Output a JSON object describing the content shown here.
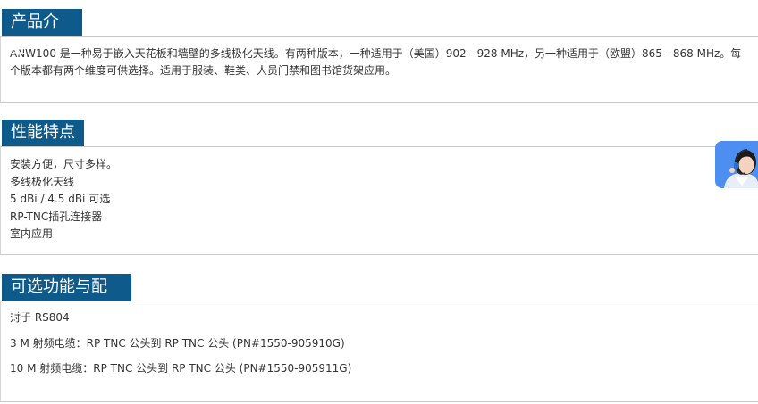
{
  "sections": {
    "intro": {
      "title": "产品介绍",
      "text": "ANW100 是一种易于嵌入天花板和墙壁的多线极化天线。有两种版本，一种适用于（美国）902 - 928 MHz，另一种适用于（欧盟）865 - 868 MHz。每个版本都有两个维度可供选择。适用于服装、鞋类、人员门禁和图书馆货架应用。"
    },
    "features": {
      "title": "性能特点",
      "items": [
        "安装方便，尺寸多样。",
        "多线极化天线",
        "5 dBi / 4.5 dBi 可选",
        "RP-TNC插孔连接器",
        "室内应用"
      ]
    },
    "accessories": {
      "title": "可选功能与配件",
      "items": [
        "对于 RS804",
        "3 M 射频电缆：RP TNC 公头到 RP TNC 公头 (PN#1550-905910G)",
        "10 M 射频电缆：RP TNC 公头到 RP TNC 公头 (PN#1550-905911G)"
      ]
    }
  },
  "widget": {
    "icon": "customer-service-agent-icon",
    "color": "#4d8ff0"
  },
  "colors": {
    "header_bg": "#0e5a8a",
    "header_text": "#ffffff",
    "border": "#c9c9c9",
    "body_text": "#333333"
  }
}
